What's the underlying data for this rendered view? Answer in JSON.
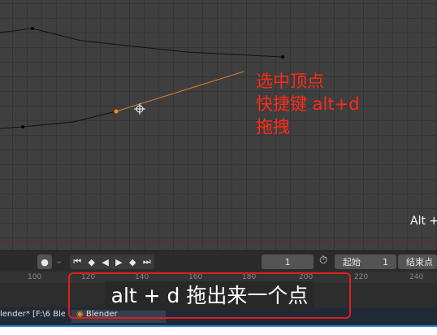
{
  "annotation": {
    "line1": "选中顶点",
    "line2": "快捷键 alt+d",
    "line3": "拖拽"
  },
  "overlay": {
    "alt_label": "Alt +"
  },
  "timeline": {
    "current_frame": "1",
    "start_label": "起始",
    "start_value": "1",
    "end_label": "结束点",
    "ruler_ticks": [
      "100",
      "120",
      "140",
      "160",
      "180",
      "200",
      "220",
      "240"
    ]
  },
  "taskbar": {
    "item1": "lender* [F:\\6 Ble...",
    "item2": "Blender"
  },
  "subtitle": {
    "text": "alt + d 拖出来一个点"
  },
  "colors": {
    "annotation": "#ff2a1a",
    "subtitle_border": "#e21c1c",
    "edge": "#d88030"
  }
}
